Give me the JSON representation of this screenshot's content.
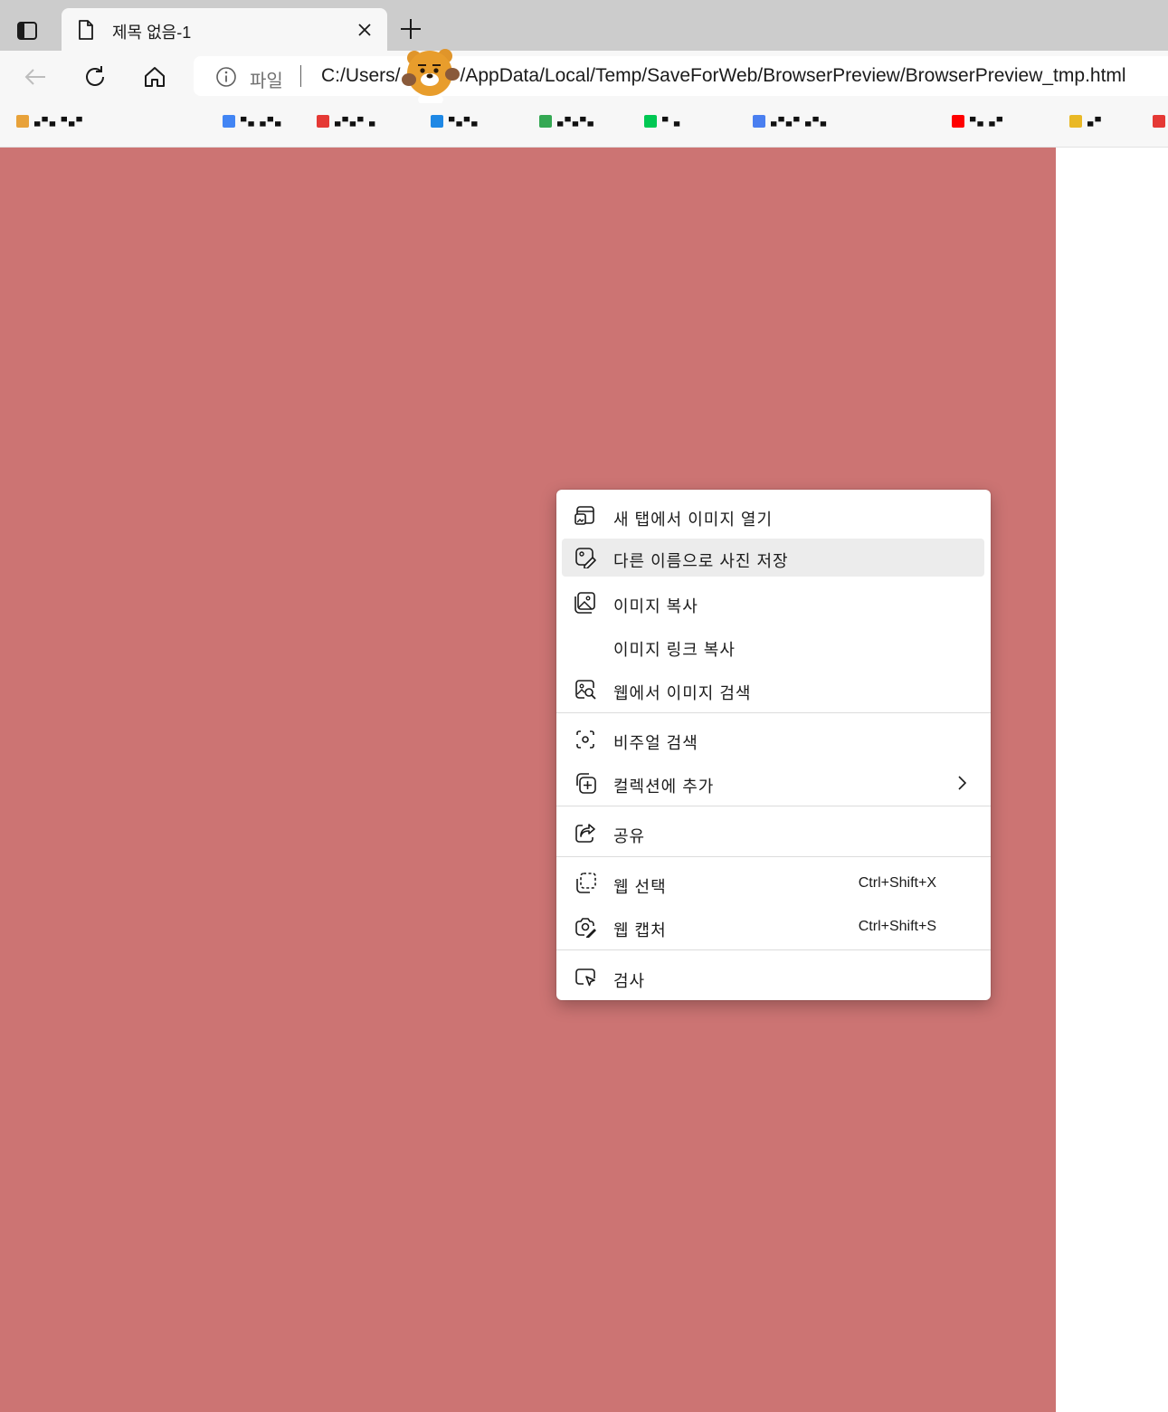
{
  "tab": {
    "title": "제목 없음-1"
  },
  "address": {
    "scheme_label": "파일",
    "url_prefix": "C:/Users/",
    "url_suffix": "/AppData/Local/Temp/SaveForWeb/BrowserPreview/BrowserPreview_tmp.html"
  },
  "favorites": [
    {
      "label": "▄▀▄ ▀▄▀",
      "color": "#e8a23a"
    },
    {
      "label": "▀▄ ▄▀▄",
      "color": "#4285f4"
    },
    {
      "label": "▄▀▄▀ ▄",
      "color": "#e53935"
    },
    {
      "label": "▀▄▀▄",
      "color": "#1e88e5"
    },
    {
      "label": "▄▀▄▀▄",
      "color": "#34a853"
    },
    {
      "label": "▀ ▄",
      "color": "#00c853"
    },
    {
      "label": "▄▀▄▀ ▄▀▄",
      "color": "#4a7ff0"
    },
    {
      "label": "▀▄ ▄▀",
      "color": "#ff0000"
    },
    {
      "label": "▄▀",
      "color": "#e9b825"
    },
    {
      "label": "",
      "color": "#e53935"
    }
  ],
  "colors": {
    "page_background": "#cc7473",
    "menu_highlight": "#ececec"
  },
  "context_menu": {
    "items": [
      {
        "label": "새 탭에서 이미지 열기",
        "icon": "open-image-new-tab-icon"
      },
      {
        "label": "다른 이름으로 사진 저장",
        "icon": "save-image-as-icon",
        "highlighted": true
      },
      {
        "label": "이미지 복사",
        "icon": "copy-image-icon"
      },
      {
        "label": "이미지 링크 복사",
        "icon": ""
      },
      {
        "label": "웹에서 이미지 검색",
        "icon": "search-image-web-icon"
      },
      {
        "label": "비주얼 검색",
        "icon": "visual-search-icon"
      },
      {
        "label": "컬렉션에 추가",
        "icon": "add-to-collections-icon",
        "submenu": true
      },
      {
        "label": "공유",
        "icon": "share-icon"
      },
      {
        "label": "웹 선택",
        "icon": "web-select-icon",
        "shortcut": "Ctrl+Shift+X"
      },
      {
        "label": "웹 캡처",
        "icon": "web-capture-icon",
        "shortcut": "Ctrl+Shift+S"
      },
      {
        "label": "검사",
        "icon": "inspect-icon"
      }
    ]
  }
}
